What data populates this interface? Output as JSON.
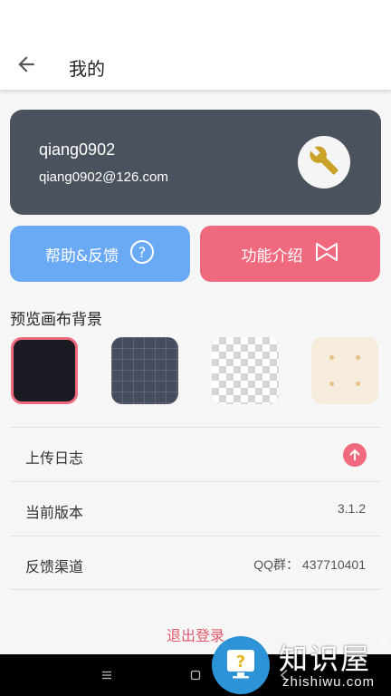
{
  "header": {
    "title": "我的",
    "back_icon": "arrow-left-icon"
  },
  "account": {
    "username": "qiang0902",
    "email": "qiang0902@126.com",
    "settings_icon": "wrench-icon",
    "card_color": "#4a535d"
  },
  "actions": {
    "help": {
      "label": "帮助&反馈",
      "icon": "question-circle-icon",
      "color": "#6aaaf5"
    },
    "features": {
      "label": "功能介绍",
      "icon": "bowtie-icon",
      "color": "#ef6a7f"
    }
  },
  "canvas_background": {
    "title": "预览画布背景",
    "options": [
      {
        "name": "dark",
        "selected": true
      },
      {
        "name": "grid",
        "selected": false
      },
      {
        "name": "transparent",
        "selected": false
      },
      {
        "name": "cream-dots",
        "selected": false
      }
    ]
  },
  "settings_list": [
    {
      "label": "上传日志",
      "value": "",
      "icon": "upload-arrow-icon"
    },
    {
      "label": "当前版本",
      "value": "3.1.2"
    },
    {
      "label": "反馈渠道",
      "value": "QQ群：  437710401"
    }
  ],
  "logout_label": "退出登录",
  "system_nav": {
    "menu_icon": "menu-icon",
    "home_icon": "home-square-icon",
    "back_icon": "back-icon"
  },
  "watermark": {
    "brand": "知识屋",
    "domain": "zhishiwu.com",
    "registered": "®"
  },
  "colors": {
    "accent_pink": "#ef6a7f",
    "accent_blue": "#6aaaf5",
    "logout": "#e05a6e"
  }
}
